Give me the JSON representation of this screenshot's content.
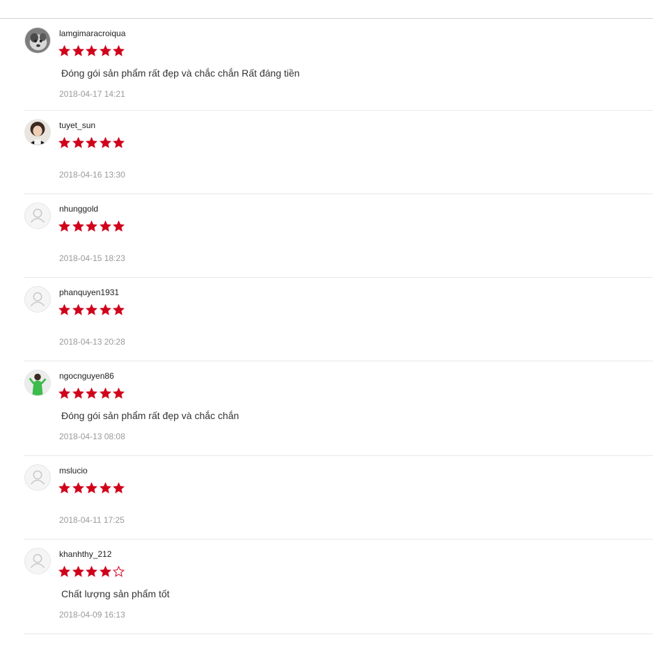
{
  "colors": {
    "star": "#d0011b",
    "divider": "#e8e8e8",
    "date": "#999999"
  },
  "reviews": [
    {
      "username": "lamgimaracroiqua",
      "rating": 5,
      "comment": "Đóng gói sản phẩm rất đẹp và chắc chắn Rất đáng tiền",
      "date": "2018-04-17 14:21",
      "avatar": "photo-dog"
    },
    {
      "username": "tuyet_sun",
      "rating": 5,
      "comment": "",
      "date": "2018-04-16 13:30",
      "avatar": "photo-girl"
    },
    {
      "username": "nhunggold",
      "rating": 5,
      "comment": "",
      "date": "2018-04-15 18:23",
      "avatar": "default-user-icon"
    },
    {
      "username": "phanquyen1931",
      "rating": 5,
      "comment": "",
      "date": "2018-04-13 20:28",
      "avatar": "default-user-icon"
    },
    {
      "username": "ngocnguyen86",
      "rating": 5,
      "comment": "Đóng gói sản phẩm rất đẹp và chắc chắn",
      "date": "2018-04-13 08:08",
      "avatar": "photo-green-figure"
    },
    {
      "username": "mslucio",
      "rating": 5,
      "comment": "",
      "date": "2018-04-11 17:25",
      "avatar": "default-user-icon"
    },
    {
      "username": "khanhthy_212",
      "rating": 4,
      "comment": "Chất lượng sản phẩm tốt",
      "date": "2018-04-09 16:13",
      "avatar": "default-user-icon"
    }
  ]
}
